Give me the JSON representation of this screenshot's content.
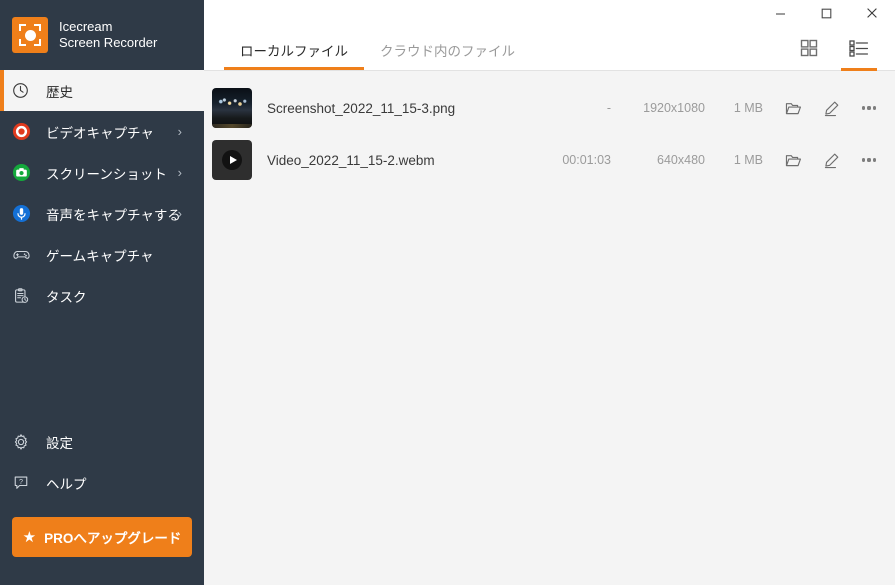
{
  "app": {
    "brand_line1": "Icecream",
    "brand_line2": "Screen Recorder",
    "logo_icon": "record-frame-icon",
    "accent_color": "#ef7f1a",
    "sidebar_bg": "#2f3a47"
  },
  "window_controls": {
    "minimize": "minimize-icon",
    "maximize": "maximize-icon",
    "close": "close-icon"
  },
  "sidebar": {
    "top_items": [
      {
        "label": "歴史",
        "icon": "clock-icon",
        "active": true,
        "chevron": false
      },
      {
        "label": "ビデオキャプチャ",
        "icon": "record-circle-icon",
        "active": false,
        "chevron": true,
        "chevron_glyph": "›"
      },
      {
        "label": "スクリーンショット",
        "icon": "camera-icon",
        "active": false,
        "chevron": true,
        "chevron_glyph": "›"
      },
      {
        "label": "音声をキャプチャする",
        "icon": "microphone-icon",
        "active": false,
        "chevron": true,
        "chevron_glyph": "›"
      },
      {
        "label": "ゲームキャプチャ",
        "icon": "gamepad-icon",
        "active": false,
        "chevron": false
      },
      {
        "label": "タスク",
        "icon": "task-clipboard-icon",
        "active": false,
        "chevron": false
      }
    ],
    "bottom_items": [
      {
        "label": "設定",
        "icon": "gear-icon"
      },
      {
        "label": "ヘルプ",
        "icon": "help-icon"
      }
    ],
    "pro_button": {
      "label": "PROへアップグレード",
      "icon": "star-icon",
      "glyph": "★"
    }
  },
  "tabs": [
    {
      "label": "ローカルファイル",
      "active": true
    },
    {
      "label": "クラウド内のファイル",
      "active": false
    }
  ],
  "view_toggles": [
    {
      "name": "grid-view",
      "icon": "grid-view-icon",
      "active": false
    },
    {
      "name": "list-view",
      "icon": "list-view-icon",
      "active": true
    }
  ],
  "files": [
    {
      "name": "Screenshot_2022_11_15-3.png",
      "thumb_type": "image",
      "duration": "-",
      "resolution": "1920x1080",
      "size": "1 MB",
      "actions": [
        "folder-icon",
        "edit-pencil-icon",
        "more-options-icon"
      ]
    },
    {
      "name": "Video_2022_11_15-2.webm",
      "thumb_type": "video",
      "duration": "00:01:03",
      "resolution": "640x480",
      "size": "1 MB",
      "actions": [
        "folder-icon",
        "edit-pencil-icon",
        "more-options-icon"
      ]
    }
  ]
}
